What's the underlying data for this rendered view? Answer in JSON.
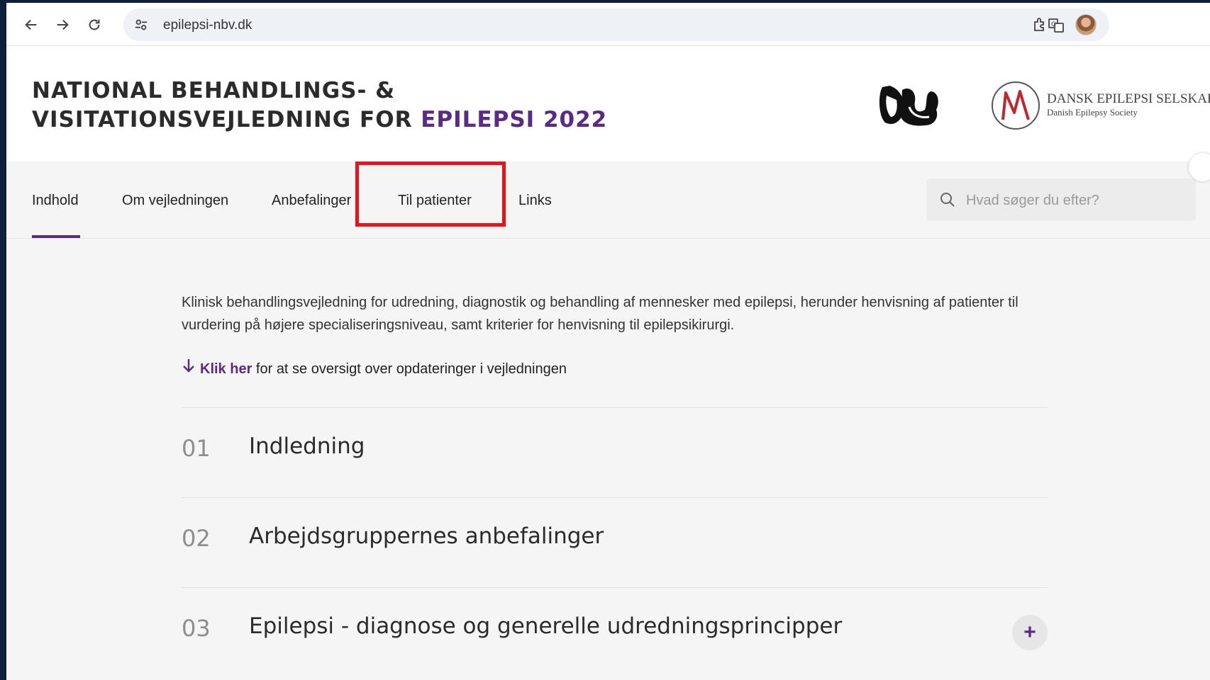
{
  "browser": {
    "url": "epilepsi-nbv.dk",
    "icons": [
      "back-icon",
      "forward-icon",
      "reload-icon",
      "site-settings-icon",
      "translate-icon",
      "bookmark-star-icon",
      "extensions-icon",
      "profile-avatar"
    ]
  },
  "header": {
    "title_line1": "NATIONAL BEHANDLINGS- &",
    "title_line2_prefix": "VISITATIONSVEJLEDNING FOR ",
    "title_line2_accent": "EPILEPSI 2022",
    "logo_des_name": "DANSK EPILEPSI SELSKAB",
    "logo_des_sub": "Danish Epilepsy Society"
  },
  "tabs": [
    {
      "label": "Indhold",
      "active": true
    },
    {
      "label": "Om vejledningen"
    },
    {
      "label": "Anbefalinger"
    },
    {
      "label": "Til patienter",
      "highlighted": true
    },
    {
      "label": "Links"
    }
  ],
  "search": {
    "placeholder": "Hvad søger du efter?"
  },
  "intro": "Klinisk behandlingsvejledning for udredning, diagnostik og behandling af mennesker med epilepsi, herunder henvisning af patienter til vurdering på højere specialiseringsniveau, samt kriterier for henvisning til epilepsikirurgi.",
  "update_link": {
    "link_text": "Klik her",
    "rest": " for at se oversigt over opdateringer i vejledningen"
  },
  "sections": [
    {
      "num": "01",
      "title": "Indledning"
    },
    {
      "num": "02",
      "title": "Arbejdsgruppernes anbefalinger"
    },
    {
      "num": "03",
      "title": "Epilepsi - diagnose og generelle udredningsprincipper",
      "expand": "+"
    }
  ],
  "colors": {
    "accent": "#5b2a86",
    "highlight": "#e8141b"
  }
}
